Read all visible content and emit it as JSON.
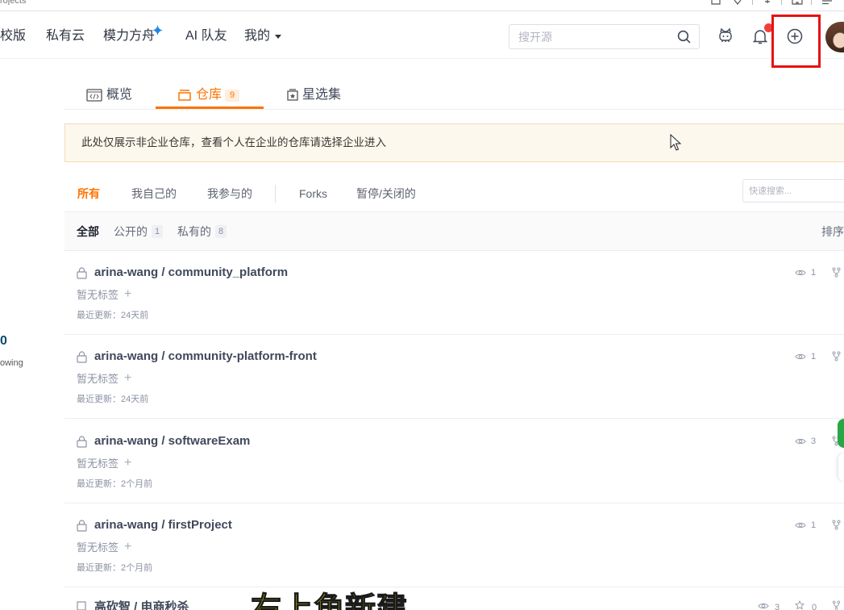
{
  "browser": {
    "tab_text": "rojects",
    "icons": [
      "split-view-icon",
      "bookmark-icon",
      "extension-icon",
      "puzzle-icon",
      "menu-icon"
    ]
  },
  "nav": {
    "items": [
      {
        "label": "校版"
      },
      {
        "label": "私有云"
      },
      {
        "label": "模力方舟",
        "icon": "sparkle-icon"
      },
      {
        "label": "AI 队友"
      },
      {
        "label": "我的",
        "icon": "caret-down-icon"
      }
    ],
    "search": {
      "placeholder": "搜开源",
      "value": ""
    },
    "actions": [
      "robot-icon",
      "bell-icon",
      "plus-circle-icon",
      "avatar"
    ]
  },
  "tabs": [
    {
      "label": "概览",
      "icon": "code-icon",
      "active": false
    },
    {
      "label": "仓库",
      "icon": "repo-icon",
      "badge": "9",
      "active": true
    },
    {
      "label": "星选集",
      "icon": "collection-icon",
      "active": false
    }
  ],
  "notice": "此处仅展示非企业仓库，查看个人在企业的仓库请选择企业进入",
  "filters": {
    "items": [
      "所有",
      "我自己的",
      "我参与的",
      "Forks",
      "暂停/关闭的"
    ],
    "active_index": 0,
    "search": {
      "placeholder": "快速搜索...",
      "value": ""
    }
  },
  "subfilters": {
    "all": "全部",
    "public": {
      "label": "公开的",
      "count": "1"
    },
    "private": {
      "label": "私有的",
      "count": "8"
    },
    "sort": "排序"
  },
  "repos": [
    {
      "icon": "lock-icon",
      "title": "arina-wang / community_platform",
      "tags_empty": "暂无标签",
      "add_tag": "+",
      "updated": "最近更新：24天前",
      "watchers": "1"
    },
    {
      "icon": "lock-icon",
      "title": "arina-wang / community-platform-front",
      "tags_empty": "暂无标签",
      "add_tag": "+",
      "updated": "最近更新：24天前",
      "watchers": "1"
    },
    {
      "icon": "lock-icon",
      "title": "arina-wang / softwareExam",
      "tags_empty": "暂无标签",
      "add_tag": "+",
      "updated": "最近更新：2个月前",
      "watchers": "3"
    },
    {
      "icon": "lock-icon",
      "title": "arina-wang / firstProject",
      "tags_empty": "暂无标签",
      "add_tag": "+",
      "updated": "最近更新：2个月前",
      "watchers": "1"
    },
    {
      "icon": "repo-square-icon",
      "title": "高砍智 / 电商秒杀",
      "watchers": "3",
      "stars": "0"
    }
  ],
  "sidebar": {
    "count": "0",
    "label": "owing"
  },
  "caption": "右上角新建",
  "colors": {
    "accent": "#fe7300",
    "highlight_box": "#e61212",
    "notification_dot": "#f23d3d",
    "sparkle": "#1e88e5",
    "notice_bg": "#fdf8ee",
    "caption_text": "#ffe600",
    "floating_button": "#27a745"
  }
}
